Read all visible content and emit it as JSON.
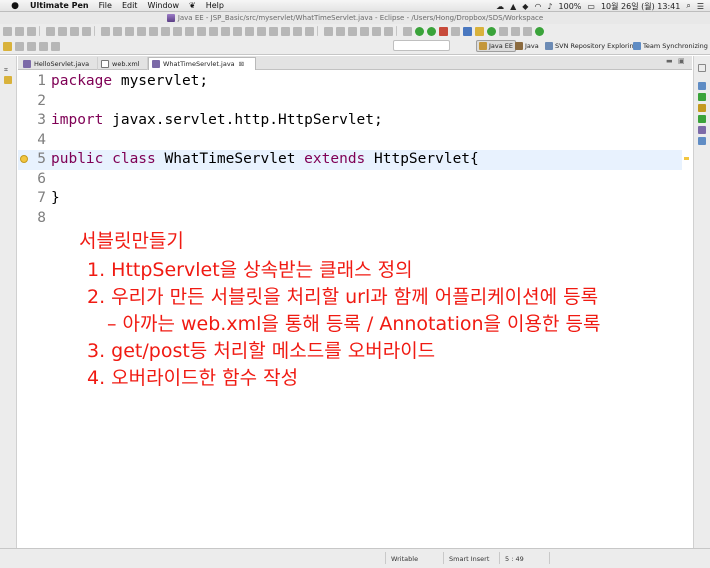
{
  "menubar": {
    "app_name": "Ultimate Pen",
    "items": [
      "File",
      "Edit",
      "Window",
      "Help"
    ],
    "battery": "100%",
    "datetime": "10월 26일 (월)  13:41"
  },
  "window": {
    "title": "Java EE - JSP_Basic/src/myservlet/WhatTimeServlet.java - Eclipse - /Users/Hong/Dropbox/SDS/Workspace"
  },
  "perspectives": [
    "Java EE",
    "Java",
    "SVN Repository Exploring",
    "Team Synchronizing"
  ],
  "tabs": [
    {
      "label": "HelloServlet.java",
      "active": false
    },
    {
      "label": "web.xml",
      "active": false
    },
    {
      "label": "WhatTimeServlet.java",
      "active": true,
      "close": "⊠"
    }
  ],
  "code_lines": [
    {
      "num": "1",
      "kw": "package",
      "rest": " myservlet;",
      "rest2": "",
      "kw2": ""
    },
    {
      "num": "2",
      "kw": "",
      "rest": "",
      "rest2": "",
      "kw2": ""
    },
    {
      "num": "3",
      "kw": "import",
      "rest": " javax.servlet.http.HttpServlet;",
      "rest2": "",
      "kw2": ""
    },
    {
      "num": "4",
      "kw": "",
      "rest": "",
      "rest2": "",
      "kw2": ""
    },
    {
      "num": "5",
      "kw": "public class",
      "rest": " WhatTimeServlet ",
      "kw2": "extends",
      "rest2": " HttpServlet{"
    },
    {
      "num": "6",
      "kw": "",
      "rest": "",
      "rest2": "",
      "kw2": ""
    },
    {
      "num": "7",
      "kw": "",
      "rest": "}",
      "rest2": "",
      "kw2": ""
    },
    {
      "num": "8",
      "kw": "",
      "rest": "",
      "rest2": "",
      "kw2": ""
    }
  ],
  "notes": {
    "heading": "서블릿만들기",
    "item1": "1. HttpServlet을 상속받는 클래스 정의",
    "item2": "2. 우리가 만든 서블릿을 처리할 url과 함께 어플리케이션에 등록",
    "item2_sub": "– 아까는 web.xml을 통해 등록 / Annotation을 이용한 등록",
    "item3": "3. get/post등 처리할 메소드를 오버라이드",
    "item4": "4. 오버라이드한 함수 작성"
  },
  "statusbar": {
    "mode": "Writable",
    "insert": "Smart Insert",
    "position": "5 : 49"
  }
}
